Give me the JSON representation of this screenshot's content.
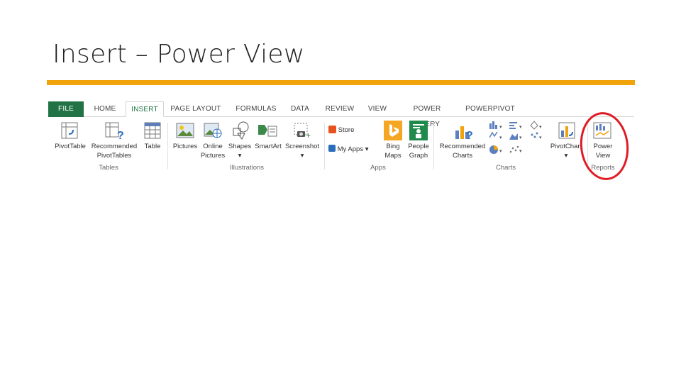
{
  "slide": {
    "title": "Insert – Power View"
  },
  "ribbon": {
    "tabs": [
      "FILE",
      "HOME",
      "INSERT",
      "PAGE LAYOUT",
      "FORMULAS",
      "DATA",
      "REVIEW",
      "VIEW",
      "POWER QUERY",
      "POWERPIVOT"
    ],
    "commands": {
      "pivottable": "PivotTable",
      "recommended_pivot_1": "Recommended",
      "recommended_pivot_2": "PivotTables",
      "table": "Table",
      "pictures": "Pictures",
      "online_1": "Online",
      "online_2": "Pictures",
      "shapes": "Shapes",
      "smartart": "SmartArt",
      "screenshot": "Screenshot",
      "store": "Store",
      "myapps": "My Apps",
      "bing_1": "Bing",
      "bing_2": "Maps",
      "people_1": "People",
      "people_2": "Graph",
      "rec_charts_1": "Recommended",
      "rec_charts_2": "Charts",
      "pivotchart": "PivotChart",
      "powerview_1": "Power",
      "powerview_2": "View"
    },
    "groups": {
      "tables": "Tables",
      "illustrations": "Illustrations",
      "apps": "Apps",
      "charts": "Charts",
      "reports": "Reports"
    }
  },
  "colors": {
    "accent_bar": "#f0a30a",
    "excel_green": "#217346",
    "highlight_circle": "#e01b24"
  }
}
